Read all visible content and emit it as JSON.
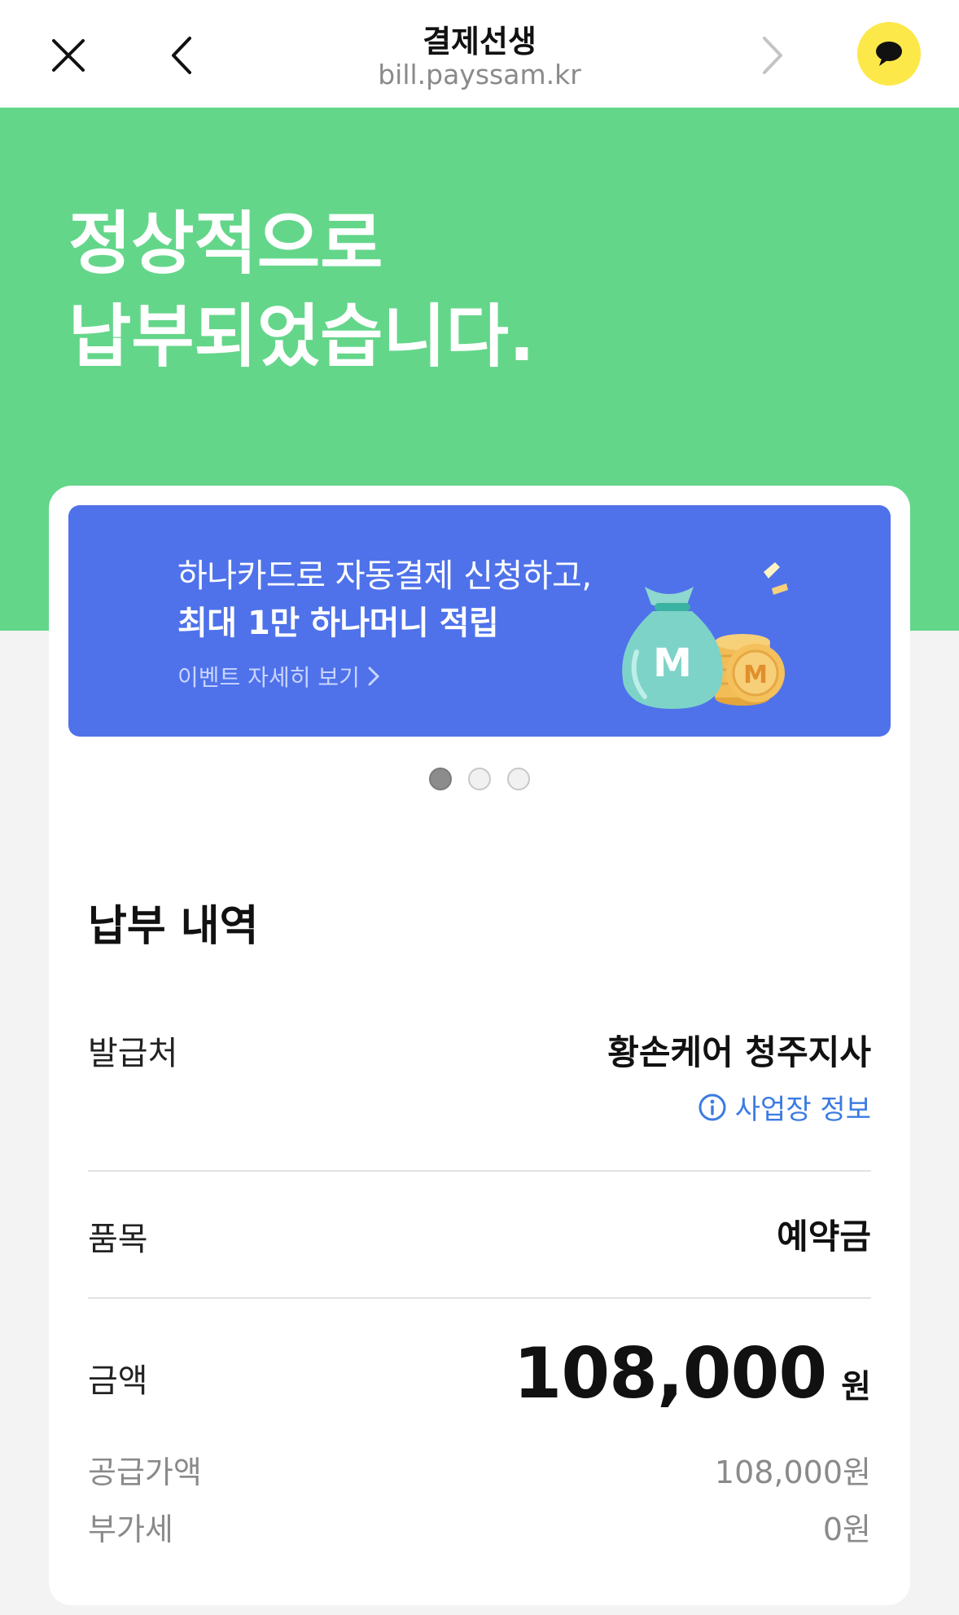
{
  "topbar": {
    "title": "결제선생",
    "url": "bill.payssam.kr"
  },
  "hero": {
    "title_line1": "정상적으로",
    "title_line2": "납부되었습니다."
  },
  "banner": {
    "line1": "하나카드로 자동결제 신청하고,",
    "line2": "최대 1만 하나머니 적립",
    "link": "이벤트 자세히 보기",
    "coin_letter": "M",
    "slide_index": 1,
    "slide_count": 3
  },
  "details": {
    "section_title": "납부 내역",
    "issuer_label": "발급처",
    "issuer_value": "황손케어 청주지사",
    "business_info_link": "사업장 정보",
    "item_label": "품목",
    "item_value": "예약금",
    "amount_label": "금액",
    "amount_value": "108,000",
    "amount_unit": "원",
    "supply_label": "공급가액",
    "supply_value": "108,000원",
    "vat_label": "부가세",
    "vat_value": "0원"
  },
  "colors": {
    "hero_green": "#64d68a",
    "banner_blue": "#4f72ea",
    "kakao_yellow": "#fde84a",
    "link_blue": "#3b7be3"
  }
}
